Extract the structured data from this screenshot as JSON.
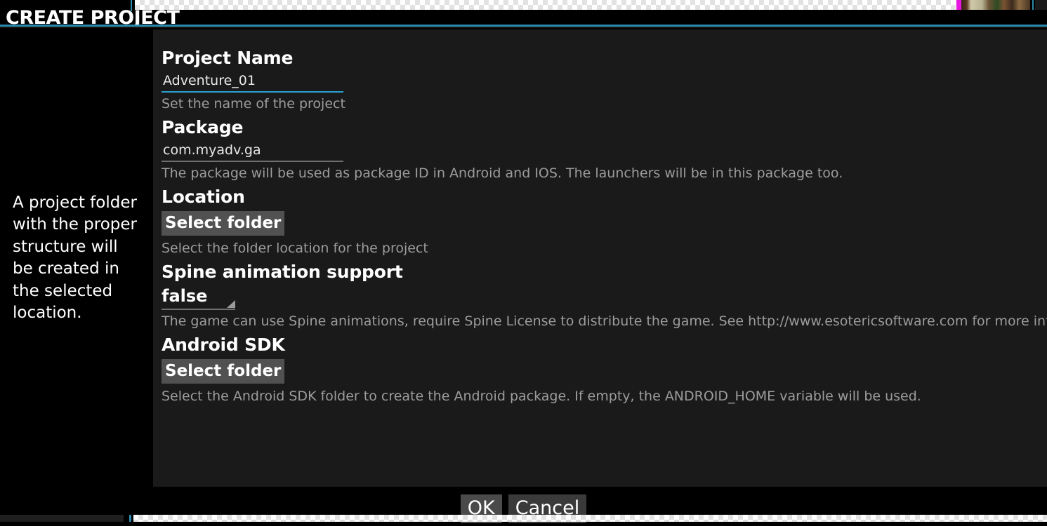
{
  "background": {
    "accent_color": "#2b89ad",
    "panel_color": "#1a1a1a"
  },
  "dialog": {
    "title": "CREATE PROJECT",
    "help_text": "A project folder with the proper structure will be created in the selected location.",
    "accent_color": "#2b9fd1",
    "fields": [
      {
        "label": "Project Name",
        "type": "text",
        "value": "Adventure_01",
        "placeholder": "",
        "focused": true,
        "hint": "Set the name of the project"
      },
      {
        "label": "Package",
        "type": "text",
        "value": "com.myadv.ga",
        "placeholder": "",
        "focused": false,
        "hint": "The package will be used as package ID in Android and IOS. The launchers will be in this package too."
      },
      {
        "label": "Location",
        "type": "button",
        "button_label": "Select folder",
        "hint": "Select the folder location for the project"
      },
      {
        "label": "Spine animation support",
        "type": "dropdown",
        "value": "false",
        "options": [
          "false",
          "true"
        ],
        "hint": "The game can use Spine animations, require Spine License to distribute the game. See http://www.esotericsoftware.com for more info."
      },
      {
        "label": "Android SDK",
        "type": "button",
        "button_label": "Select folder",
        "hint": "Select the Android SDK folder to create the Android package. If empty, the ANDROID_HOME variable will be used."
      }
    ],
    "footer": {
      "ok_label": "OK",
      "cancel_label": "Cancel"
    }
  }
}
